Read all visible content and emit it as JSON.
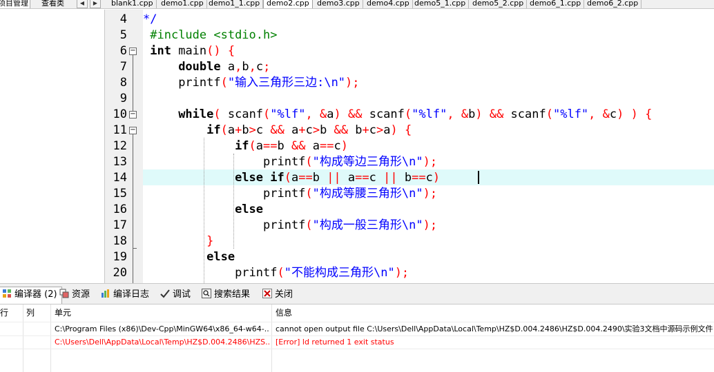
{
  "left_tabs": [
    {
      "label": "项目管理",
      "active": true
    },
    {
      "label": "查看类",
      "active": false
    }
  ],
  "nav": {
    "prev": "◀",
    "next": "▶"
  },
  "file_tabs": [
    {
      "label": "blank1.cpp",
      "active": false
    },
    {
      "label": "demo1.cpp",
      "active": false
    },
    {
      "label": "demo1_1.cpp",
      "active": false
    },
    {
      "label": "demo2.cpp",
      "active": true
    },
    {
      "label": "demo3.cpp",
      "active": false
    },
    {
      "label": "demo4.cpp",
      "active": false
    },
    {
      "label": "demo5_1.cpp",
      "active": false
    },
    {
      "label": "demo5_2.cpp",
      "active": false
    },
    {
      "label": "demo6_1.cpp",
      "active": false
    },
    {
      "label": "demo6_2.cpp",
      "active": false
    }
  ],
  "editor": {
    "current_line": 14,
    "lines": [
      {
        "n": "4",
        "indent": "",
        "tokens": [
          [
            "cm",
            "*/"
          ]
        ]
      },
      {
        "n": "5",
        "indent": " ",
        "tokens": [
          [
            "pp",
            "#include <stdio.h>"
          ]
        ]
      },
      {
        "n": "6",
        "indent": " ",
        "tokens": [
          [
            "kw",
            "int"
          ],
          [
            "",
            " main"
          ],
          [
            "op",
            "()"
          ],
          [
            "",
            " "
          ],
          [
            "op",
            "{"
          ]
        ]
      },
      {
        "n": "7",
        "indent": "     ",
        "tokens": [
          [
            "kw",
            "double"
          ],
          [
            "",
            " a"
          ],
          [
            "op",
            ","
          ],
          [
            "",
            "b"
          ],
          [
            "op",
            ","
          ],
          [
            "",
            "c"
          ],
          [
            "op",
            ";"
          ]
        ]
      },
      {
        "n": "8",
        "indent": "     ",
        "tokens": [
          [
            "",
            "printf"
          ],
          [
            "op",
            "("
          ],
          [
            "str",
            "\"输入三角形三边:\\n\""
          ],
          [
            "op",
            ");"
          ]
        ]
      },
      {
        "n": "9",
        "indent": "",
        "tokens": []
      },
      {
        "n": "10",
        "indent": "     ",
        "tokens": [
          [
            "kw",
            "while"
          ],
          [
            "op",
            "("
          ],
          [
            "",
            " scanf"
          ],
          [
            "op",
            "("
          ],
          [
            "str",
            "\"%lf\""
          ],
          [
            "op",
            ","
          ],
          [
            "",
            " "
          ],
          [
            "op",
            "&"
          ],
          [
            "",
            "a"
          ],
          [
            "op",
            ")"
          ],
          [
            "",
            " "
          ],
          [
            "op",
            "&&"
          ],
          [
            "",
            " scanf"
          ],
          [
            "op",
            "("
          ],
          [
            "str",
            "\"%lf\""
          ],
          [
            "op",
            ","
          ],
          [
            "",
            " "
          ],
          [
            "op",
            "&"
          ],
          [
            "",
            "b"
          ],
          [
            "op",
            ")"
          ],
          [
            "",
            " "
          ],
          [
            "op",
            "&&"
          ],
          [
            "",
            " scanf"
          ],
          [
            "op",
            "("
          ],
          [
            "str",
            "\"%lf\""
          ],
          [
            "op",
            ","
          ],
          [
            "",
            " "
          ],
          [
            "op",
            "&"
          ],
          [
            "",
            "c"
          ],
          [
            "op",
            ")"
          ],
          [
            "",
            " "
          ],
          [
            "op",
            ")"
          ],
          [
            "",
            " "
          ],
          [
            "op",
            "{"
          ]
        ]
      },
      {
        "n": "11",
        "indent": "         ",
        "tokens": [
          [
            "kw",
            "if"
          ],
          [
            "op",
            "("
          ],
          [
            "",
            "a"
          ],
          [
            "op",
            "+"
          ],
          [
            "",
            "b"
          ],
          [
            "op",
            ">"
          ],
          [
            "",
            "c "
          ],
          [
            "op",
            "&&"
          ],
          [
            "",
            " a"
          ],
          [
            "op",
            "+"
          ],
          [
            "",
            "c"
          ],
          [
            "op",
            ">"
          ],
          [
            "",
            "b "
          ],
          [
            "op",
            "&&"
          ],
          [
            "",
            " b"
          ],
          [
            "op",
            "+"
          ],
          [
            "",
            "c"
          ],
          [
            "op",
            ">"
          ],
          [
            "",
            "a"
          ],
          [
            "op",
            ")"
          ],
          [
            "",
            " "
          ],
          [
            "op",
            "{"
          ]
        ]
      },
      {
        "n": "12",
        "indent": "             ",
        "tokens": [
          [
            "kw",
            "if"
          ],
          [
            "op",
            "("
          ],
          [
            "",
            "a"
          ],
          [
            "op",
            "=="
          ],
          [
            "",
            "b "
          ],
          [
            "op",
            "&&"
          ],
          [
            "",
            " a"
          ],
          [
            "op",
            "=="
          ],
          [
            "",
            "c"
          ],
          [
            "op",
            ")"
          ]
        ]
      },
      {
        "n": "13",
        "indent": "                 ",
        "tokens": [
          [
            "",
            "printf"
          ],
          [
            "op",
            "("
          ],
          [
            "str",
            "\"构成等边三角形\\n\""
          ],
          [
            "op",
            ");"
          ]
        ]
      },
      {
        "n": "14",
        "indent": "             ",
        "tokens": [
          [
            "kw",
            "else if"
          ],
          [
            "op",
            "("
          ],
          [
            "",
            "a"
          ],
          [
            "op",
            "=="
          ],
          [
            "",
            "b "
          ],
          [
            "op",
            "||"
          ],
          [
            "",
            " a"
          ],
          [
            "op",
            "=="
          ],
          [
            "",
            "c "
          ],
          [
            "op",
            "||"
          ],
          [
            "",
            " b"
          ],
          [
            "op",
            "=="
          ],
          [
            "",
            "c"
          ],
          [
            "op",
            ")"
          ]
        ]
      },
      {
        "n": "15",
        "indent": "                 ",
        "tokens": [
          [
            "",
            "printf"
          ],
          [
            "op",
            "("
          ],
          [
            "str",
            "\"构成等腰三角形\\n\""
          ],
          [
            "op",
            ");"
          ]
        ]
      },
      {
        "n": "16",
        "indent": "             ",
        "tokens": [
          [
            "kw",
            "else"
          ]
        ]
      },
      {
        "n": "17",
        "indent": "                 ",
        "tokens": [
          [
            "",
            "printf"
          ],
          [
            "op",
            "("
          ],
          [
            "str",
            "\"构成一般三角形\\n\""
          ],
          [
            "op",
            ");"
          ]
        ]
      },
      {
        "n": "18",
        "indent": "         ",
        "tokens": [
          [
            "op",
            "}"
          ]
        ]
      },
      {
        "n": "19",
        "indent": "         ",
        "tokens": [
          [
            "kw",
            "else"
          ]
        ]
      },
      {
        "n": "20",
        "indent": "             ",
        "tokens": [
          [
            "",
            "printf"
          ],
          [
            "op",
            "("
          ],
          [
            "str",
            "\"不能构成三角形\\n\""
          ],
          [
            "op",
            ");"
          ]
        ]
      }
    ]
  },
  "bottom_tabs": [
    {
      "label": "编译器 (2)",
      "icon": "compiler-icon",
      "active": true
    },
    {
      "label": "资源",
      "icon": "resources-icon",
      "active": false
    },
    {
      "label": "编译日志",
      "icon": "compile-log-icon",
      "active": false
    },
    {
      "label": "调试",
      "icon": "debug-icon",
      "active": false
    },
    {
      "label": "搜索结果",
      "icon": "search-results-icon",
      "active": false
    },
    {
      "label": "关闭",
      "icon": "close-icon",
      "active": false
    }
  ],
  "messages": {
    "headers": {
      "row": "行",
      "col": "列",
      "unit": "单元",
      "info": "信息"
    },
    "rows": [
      {
        "row": "",
        "col": "",
        "unit": "C:\\Program Files (x86)\\Dev-Cpp\\MinGW64\\x86_64-w64-...",
        "info": "cannot open output file C:\\Users\\Dell\\AppData\\Local\\Temp\\HZ$D.004.2486\\HZ$D.004.2490\\实验3文档中源码示例文件",
        "color": "black"
      },
      {
        "row": "",
        "col": "",
        "unit": "C:\\Users\\Dell\\AppData\\Local\\Temp\\HZ$D.004.2486\\HZS...",
        "info": "[Error] ld returned 1 exit status",
        "color": "red"
      }
    ]
  },
  "colors": {
    "current_line": "#dffafa",
    "keyword": "#000000",
    "string": "#0000ff",
    "operator": "#ff0000",
    "preprocessor": "#008000",
    "error": "#ff0000"
  }
}
